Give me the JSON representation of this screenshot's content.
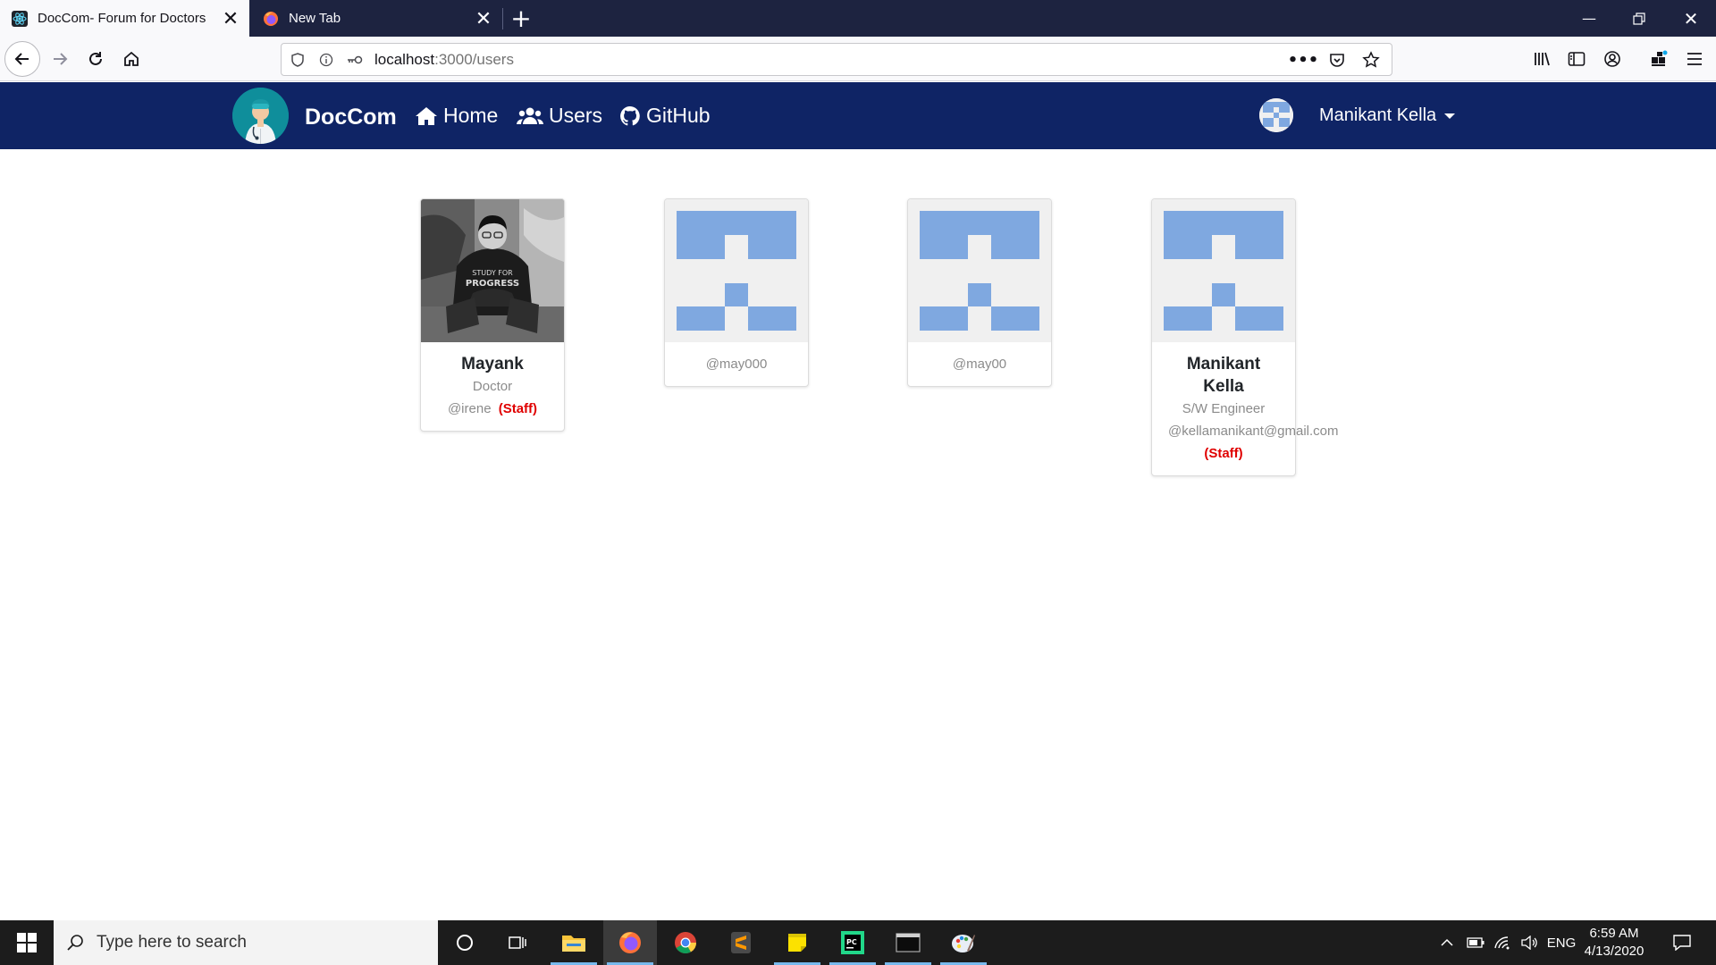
{
  "browser": {
    "tabs": [
      {
        "title": "DocCom- Forum for Doctors",
        "active": true
      },
      {
        "title": "New Tab",
        "active": false
      }
    ],
    "url_host": "localhost",
    "url_rest": ":3000/users"
  },
  "navbar": {
    "brand": "DocCom",
    "links": [
      {
        "label": "Home",
        "icon": "home-icon"
      },
      {
        "label": "Users",
        "icon": "users-icon"
      },
      {
        "label": "GitHub",
        "icon": "github-icon"
      }
    ],
    "user_name": "Manikant Kella"
  },
  "users": [
    {
      "name": "Mayank",
      "role": "Doctor",
      "handle": "@irene",
      "staff": "(Staff)",
      "avatar": "photo"
    },
    {
      "name": "",
      "role": "",
      "handle": "@may000",
      "staff": "",
      "avatar": "identicon"
    },
    {
      "name": "",
      "role": "",
      "handle": "@may00",
      "staff": "",
      "avatar": "identicon"
    },
    {
      "name": "Manikant Kella",
      "role": "S/W Engineer",
      "handle": "@kellamanikant@gmail.com",
      "staff": "(Staff)",
      "avatar": "identicon"
    }
  ],
  "taskbar": {
    "search_placeholder": "Type here to search",
    "language": "ENG",
    "time": "6:59 AM",
    "date": "4/13/2020",
    "apps": [
      "cortana-icon",
      "task-view-icon",
      "file-explorer-icon",
      "firefox-icon",
      "chrome-icon",
      "sublime-text-icon",
      "sticky-notes-icon",
      "pycharm-icon",
      "terminal-icon",
      "paint-icon"
    ]
  },
  "colors": {
    "navbar_bg": "#0f2465",
    "identicon": "#7fa8e0",
    "staff": "#e00000"
  }
}
